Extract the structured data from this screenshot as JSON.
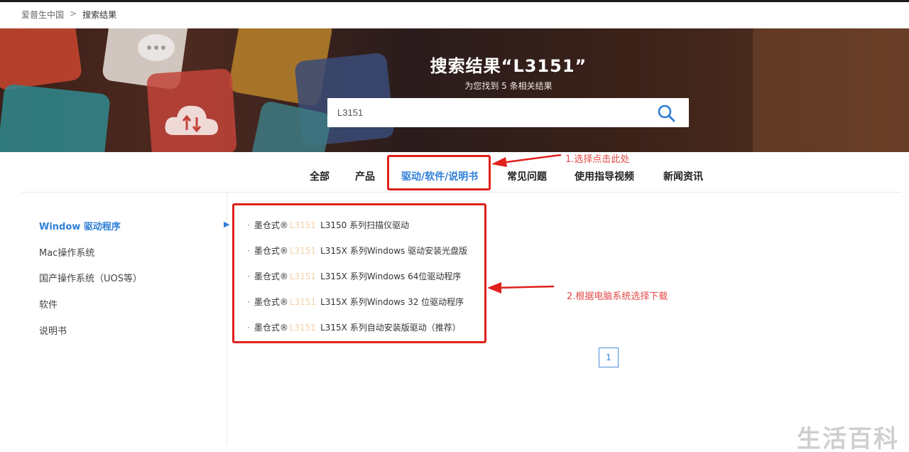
{
  "breadcrumb": {
    "home": "爱普生中国",
    "separator": ">",
    "current": "搜索结果"
  },
  "hero": {
    "title": "搜索结果“L3151”",
    "subtitle": "为您找到 5 条相关结果"
  },
  "search": {
    "value": "L3151",
    "icon": "search-icon"
  },
  "tabs": [
    "全部",
    "产品",
    "驱动/软件/说明书",
    "常见问题",
    "使用指导视频",
    "新闻资讯"
  ],
  "active_tab": "驱动/软件/说明书",
  "sidebar": {
    "items": [
      "Window 驱动程序",
      "Mac操作系统",
      "国产操作系统（UOS等）",
      "软件",
      "说明书"
    ],
    "active": "Window 驱动程序"
  },
  "results": [
    {
      "prefix": "墨仓式®",
      "model": "L3151",
      "text": "L3150 系列扫描仪驱动"
    },
    {
      "prefix": "墨仓式®",
      "model": "L3151",
      "text": "L315X 系列Windows 驱动安装光盘版"
    },
    {
      "prefix": "墨仓式®",
      "model": "L3151",
      "text": "L315X 系列Windows 64位驱动程序"
    },
    {
      "prefix": "墨仓式®",
      "model": "L3151",
      "text": "L315X 系列Windows 32 位驱动程序"
    },
    {
      "prefix": "墨仓式®",
      "model": "L3151",
      "text": "L315X 系列自动安装版驱动（推荐）"
    }
  ],
  "annotations": {
    "step1": "1.选择点击此处",
    "step2": "2.根据电脑系统选择下载"
  },
  "pagination": {
    "current_page": "1"
  },
  "watermark": "生活百科",
  "colors": {
    "accent": "#2f7fd6",
    "highlight": "#e0211c",
    "annotation_text": "#e24a45"
  }
}
